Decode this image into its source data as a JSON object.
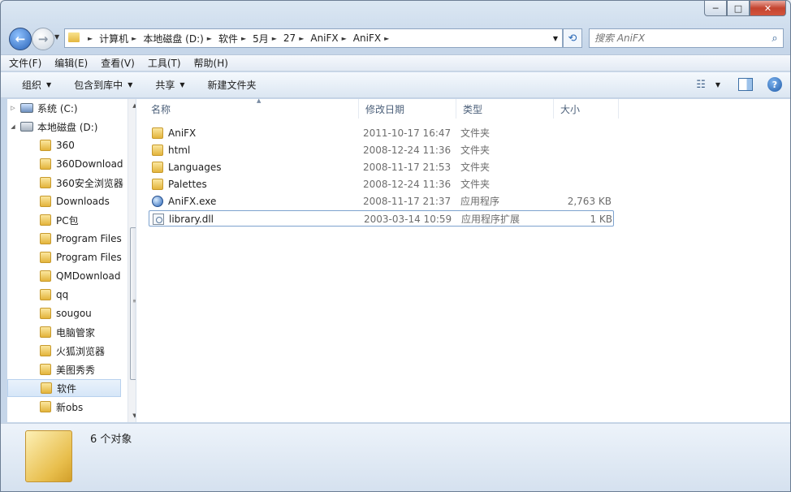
{
  "window": {
    "caption_min": "─",
    "caption_max": "□",
    "caption_close": "✕"
  },
  "nav": {
    "back_glyph": "←",
    "forward_glyph": "→",
    "history_glyph": "▼"
  },
  "address": {
    "crumbs": [
      "计算机",
      "本地磁盘 (D:)",
      "软件",
      "5月",
      "27",
      "AniFX",
      "AniFX"
    ],
    "separator": "►",
    "dropdown_glyph": "▼",
    "refresh_glyph": "⟲"
  },
  "search": {
    "placeholder": "搜索 AniFX",
    "icon_glyph": "⌕"
  },
  "menubar": [
    "文件(F)",
    "编辑(E)",
    "查看(V)",
    "工具(T)",
    "帮助(H)"
  ],
  "commandbar": {
    "organize": "组织",
    "include_library": "包含到库中",
    "share": "共享",
    "new_folder": "新建文件夹",
    "dropdown_glyph": "▼",
    "view_glyph": "☷",
    "help_glyph": "?"
  },
  "tree": [
    {
      "label": "系统 (C:)",
      "kind": "sysdrive",
      "arrow": "▷"
    },
    {
      "label": "本地磁盘 (D:)",
      "kind": "drive",
      "arrow": "◢"
    },
    {
      "label": "360",
      "kind": "folder"
    },
    {
      "label": "360Download",
      "kind": "folder"
    },
    {
      "label": "360安全浏览器",
      "kind": "folder"
    },
    {
      "label": "Downloads",
      "kind": "folder"
    },
    {
      "label": "PC包",
      "kind": "folder"
    },
    {
      "label": "Program Files",
      "kind": "folder"
    },
    {
      "label": "Program Files",
      "kind": "folder"
    },
    {
      "label": "QMDownload",
      "kind": "folder"
    },
    {
      "label": "qq",
      "kind": "folder"
    },
    {
      "label": "sougou",
      "kind": "folder"
    },
    {
      "label": "电脑管家",
      "kind": "folder"
    },
    {
      "label": "火狐浏览器",
      "kind": "folder"
    },
    {
      "label": "美图秀秀",
      "kind": "folder"
    },
    {
      "label": "软件",
      "kind": "folder",
      "selected": true
    },
    {
      "label": "新obs",
      "kind": "folder"
    }
  ],
  "scrollbar": {
    "up": "▲",
    "down": "▼",
    "grip": "≡"
  },
  "columns": {
    "name": "名称",
    "date": "修改日期",
    "type": "类型",
    "size": "大小",
    "sort_glyph": "▲"
  },
  "files": [
    {
      "name": "AniFX",
      "date": "2011-10-17 16:47",
      "type": "文件夹",
      "size": "",
      "icon": "folder"
    },
    {
      "name": "html",
      "date": "2008-12-24 11:36",
      "type": "文件夹",
      "size": "",
      "icon": "folder"
    },
    {
      "name": "Languages",
      "date": "2008-11-17 21:53",
      "type": "文件夹",
      "size": "",
      "icon": "folder"
    },
    {
      "name": "Palettes",
      "date": "2008-12-24 11:36",
      "type": "文件夹",
      "size": "",
      "icon": "folder"
    },
    {
      "name": "AniFX.exe",
      "date": "2008-11-17 21:37",
      "type": "应用程序",
      "size": "2,763 KB",
      "icon": "exe"
    },
    {
      "name": "library.dll",
      "date": "2003-03-14 10:59",
      "type": "应用程序扩展",
      "size": "1 KB",
      "icon": "dll",
      "focused": true
    }
  ],
  "status": {
    "count": "6 个对象"
  }
}
